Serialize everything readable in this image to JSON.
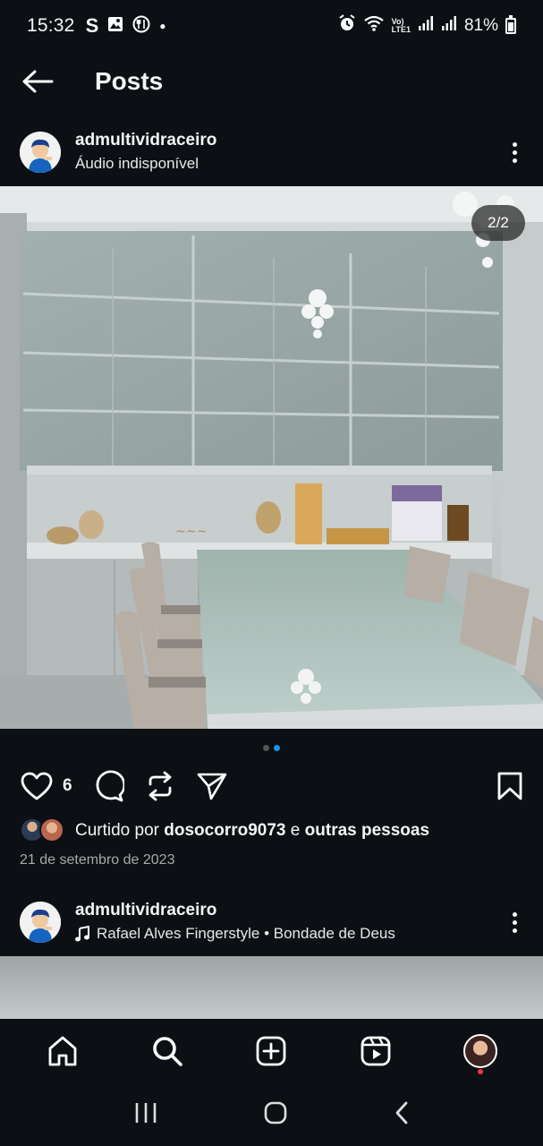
{
  "status_bar": {
    "time": "15:32",
    "left_icons": [
      "s-app-icon",
      "gallery-icon",
      "food-app-icon"
    ],
    "right_icons": [
      "alarm-icon",
      "wifi-icon",
      "volte-icon",
      "signal-icon",
      "signal-icon-2"
    ],
    "volte_label": "Vo)\nLTE1",
    "battery": "81%"
  },
  "header": {
    "title": "Posts",
    "back_icon": "arrow-left-icon"
  },
  "post": {
    "username": "admultividraceiro",
    "audio": "Áudio indisponível",
    "carousel_counter": "2/2",
    "carousel": {
      "count": 2,
      "active": 2
    },
    "likes_count": "6",
    "liked_by_prefix": "Curtido por",
    "liked_by_user": "dosocorro9073",
    "liked_by_connector": "e",
    "liked_by_others": "outras pessoas",
    "date": "21 de setembro de 2023"
  },
  "next_post": {
    "username": "admultividraceiro",
    "audio": "Rafael Alves Fingerstyle • Bondade de Deus"
  },
  "bottom_nav": [
    "home-icon",
    "search-icon",
    "create-icon",
    "reels-icon",
    "profile-avatar"
  ],
  "android_nav": [
    "recent-apps-icon",
    "home-button-icon",
    "back-icon"
  ],
  "colors": {
    "background": "#0c1014",
    "accent": "#1f8ff0",
    "notification": "#ff3040"
  }
}
